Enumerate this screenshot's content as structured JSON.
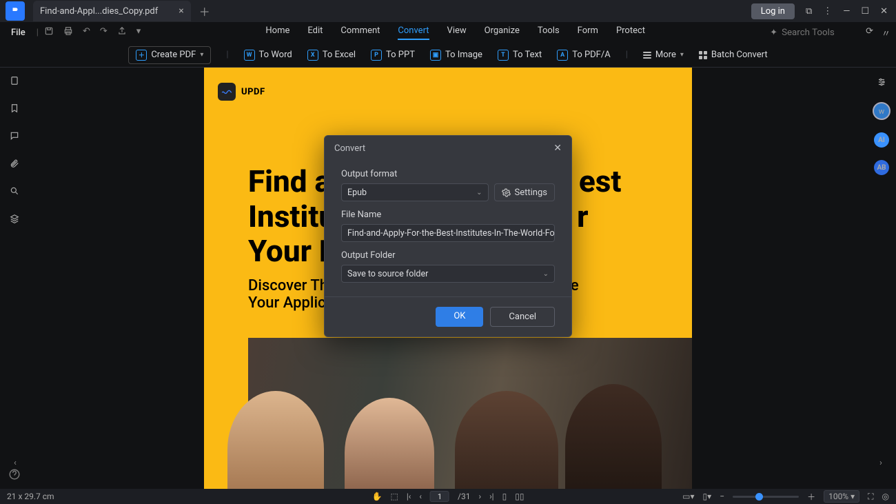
{
  "titlebar": {
    "tab_title": "Find-and-Appl...dies_Copy.pdf",
    "login": "Log in"
  },
  "menubar": {
    "file": "File",
    "items": [
      "Home",
      "Edit",
      "Comment",
      "Convert",
      "View",
      "Organize",
      "Tools",
      "Form",
      "Protect"
    ],
    "active_index": 3,
    "search_placeholder": "Search Tools"
  },
  "ribbon": {
    "create_pdf": "Create PDF",
    "to_word": "To Word",
    "to_excel": "To Excel",
    "to_ppt": "To PPT",
    "to_image": "To Image",
    "to_text": "To Text",
    "to_pdfa": "To PDF/A",
    "more": "More",
    "batch": "Batch Convert"
  },
  "page": {
    "brand": "UPDF",
    "headline_l1": "Find a",
    "headline_l2": "Institu",
    "headline_l3": "Your H",
    "headline_r1": "est",
    "headline_r2": "r",
    "sub_l1": "Discover The",
    "sub_l2": "Your Applica",
    "sub_r1": "e"
  },
  "dialog": {
    "title": "Convert",
    "output_format_label": "Output format",
    "output_format_value": "Epub",
    "settings": "Settings",
    "file_name_label": "File Name",
    "file_name_value": "Find-and-Apply-For-the-Best-Institutes-In-The-World-For-Your-H",
    "output_folder_label": "Output Folder",
    "output_folder_value": "Save to source folder",
    "ok": "OK",
    "cancel": "Cancel"
  },
  "status": {
    "dims": "21 x 29.7 cm",
    "page_current": "1",
    "page_total": "/31",
    "zoom": "100%"
  },
  "right_rail": {
    "ai": "AI",
    "ab": "AB"
  }
}
